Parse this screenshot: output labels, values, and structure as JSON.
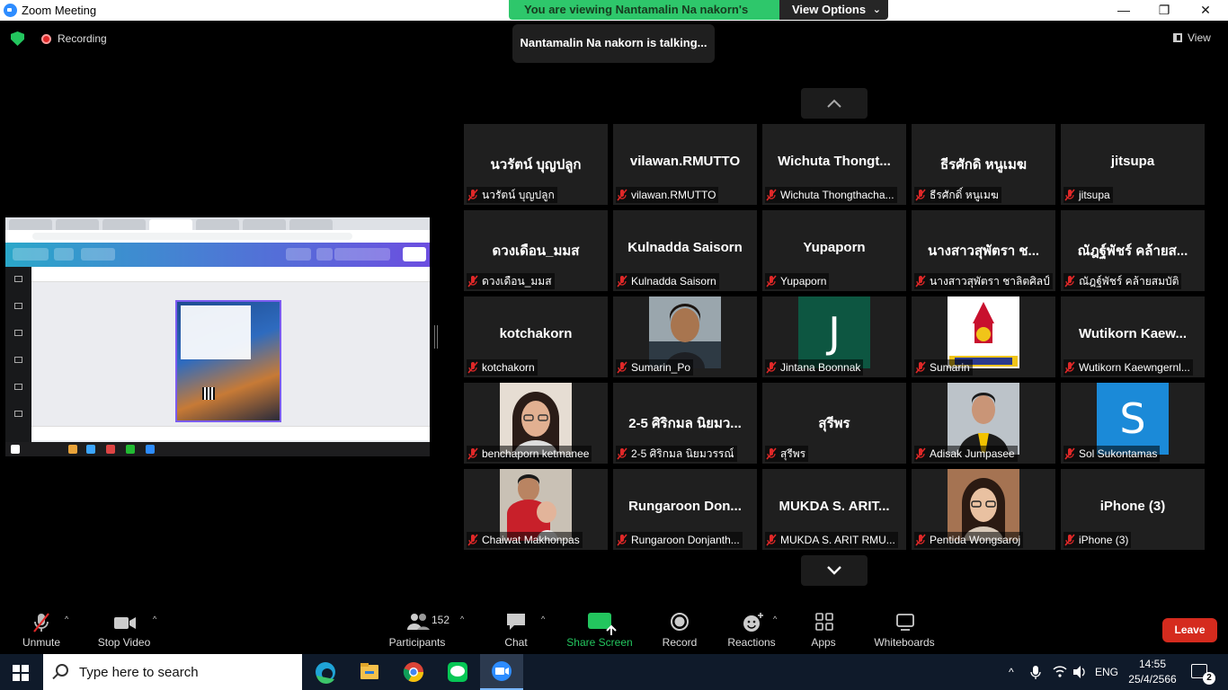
{
  "window": {
    "title": "Zoom Meeting"
  },
  "banner": {
    "viewing": "You are viewing Nantamalin Na nakorn's screen",
    "view_options": "View Options"
  },
  "talking": "Nantamalin Na nakorn is talking...",
  "recording": "Recording",
  "view": "View",
  "participants": [
    {
      "display": "นวรัตน์  บุญปลูก",
      "name": "นวรัตน์  บุญปลูก"
    },
    {
      "display": "vilawan.RMUTTO",
      "name": "vilawan.RMUTTO"
    },
    {
      "display": "Wichuta  Thongt...",
      "name": "Wichuta Thongthacha..."
    },
    {
      "display": "ธีรศักดิ หนูเมฆ",
      "name": "ธีรศักดิ์ หนูเมฆ"
    },
    {
      "display": "jitsupa",
      "name": "jitsupa"
    },
    {
      "display": "ดวงเดือน_มมส",
      "name": "ดวงเดือน_มมส"
    },
    {
      "display": "Kulnadda Saisorn",
      "name": "Kulnadda Saisorn"
    },
    {
      "display": "Yupaporn",
      "name": "Yupaporn"
    },
    {
      "display": "นางสาวสุพัตรา  ช...",
      "name": "นางสาวสุพัตรา  ชาลิตศิลป์"
    },
    {
      "display": "ณัฎฐ์พัชร์ คล้ายส...",
      "name": "ณัฎฐ์พัชร์ คล้ายสมบัติ"
    },
    {
      "display": "kotchakorn",
      "name": "kotchakorn"
    },
    {
      "display": "",
      "name": "Sumarin_Po",
      "pic": "woman-short-hair"
    },
    {
      "display": "",
      "name": "Jintana Boonnak",
      "letter": "J",
      "color": "#0d5641"
    },
    {
      "display": "",
      "name": "Sumarin",
      "pic": "university-logo"
    },
    {
      "display": "Wutikorn  Kaew...",
      "name": "Wutikorn Kaewngernl..."
    },
    {
      "display": "",
      "name": "benchaporn ketmanee",
      "pic": "woman-glasses"
    },
    {
      "display": "2-5 ศิริกมล นิยมว...",
      "name": "2-5 ศิริกมล นิยมวรรณ์"
    },
    {
      "display": "สุรีพร",
      "name": "สุรีพร"
    },
    {
      "display": "",
      "name": "Adisak Jumpasee",
      "pic": "man-suit"
    },
    {
      "display": "",
      "name": "Sol Sukontamas",
      "letter": "S",
      "color": "#1b8ad8"
    },
    {
      "display": "",
      "name": "Chaiwat Makhonpas",
      "pic": "man-with-child"
    },
    {
      "display": "Rungaroon  Don...",
      "name": "Rungaroon Donjanth..."
    },
    {
      "display": "MUKDA  S.  ARIT...",
      "name": "MUKDA S. ARIT RMU..."
    },
    {
      "display": "",
      "name": "Pentida Wongsaroj",
      "pic": "woman-glasses-2"
    },
    {
      "display": "iPhone (3)",
      "name": "iPhone (3)"
    }
  ],
  "toolbar": {
    "unmute": "Unmute",
    "stop_video": "Stop Video",
    "participants": "Participants",
    "participants_count": "152",
    "chat": "Chat",
    "share_screen": "Share Screen",
    "record": "Record",
    "reactions": "Reactions",
    "apps": "Apps",
    "whiteboards": "Whiteboards",
    "leave": "Leave"
  },
  "colors": {
    "share_green": "#23c55e",
    "leave_red": "#d52b1e",
    "muted_red": "#e02828"
  },
  "taskbar": {
    "search_placeholder": "Type here to search",
    "lang": "ENG",
    "time": "14:55",
    "date": "25/4/2566",
    "notifications": "2"
  }
}
